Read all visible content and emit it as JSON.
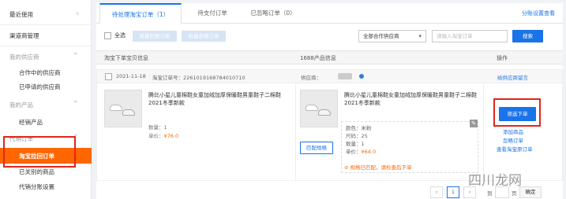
{
  "sidebar": {
    "items": [
      {
        "label": "最近使用",
        "type": "top"
      },
      {
        "label": "渠道商管理",
        "type": "top"
      },
      {
        "label": "我的供应商",
        "type": "group"
      },
      {
        "label": "合作中的供应商",
        "type": "sub"
      },
      {
        "label": "已申请的供应商",
        "type": "sub"
      },
      {
        "label": "我的产品",
        "type": "group"
      },
      {
        "label": "经销产品",
        "type": "sub"
      },
      {
        "label": "代销订单",
        "type": "group"
      },
      {
        "label": "淘宝拉回订单",
        "type": "active"
      },
      {
        "label": "已关别的商品",
        "type": "sub"
      },
      {
        "label": "代销分账设置",
        "type": "sub"
      }
    ]
  },
  "tabs": [
    {
      "label": "待处理淘宝订单（1）"
    },
    {
      "label": "待支付订单"
    },
    {
      "label": "已忽略订单（0）"
    }
  ],
  "tab_link": "分账设置查看",
  "toolbar": {
    "select_all": "全选",
    "btn_batch1": "批量匹配订单",
    "btn_batch2": "批量忽略订单",
    "supplier_select": "全部合作供应商",
    "search_placeholder": "请输入淘宝订单",
    "search_button": "搜索"
  },
  "table_header": {
    "col1": "淘宝下单宝贝信息",
    "col2": "1688产品信息",
    "col3": "操作"
  },
  "order": {
    "date": "2021-11-18",
    "order_no": "淘宝订单号：2261019168784010710",
    "supplier_label": "供应商：",
    "contact_link": "给供应商留言",
    "taobao_item": {
      "title": "腾比小星儿童棉鞋女童加绒加厚保暖鞋男童鞋子二棉鞋2021冬季新款",
      "qty": "数量：1",
      "price_label": "单价：",
      "price": "¥76.0"
    },
    "ali_item": {
      "title": "腾比小星儿童棉鞋女童加绒加厚保暖鞋男童鞋子二棉鞋2021冬季新款",
      "match_button": "匹配规格",
      "color": "颜色：米粉",
      "size": "尺码：25",
      "qty": "数量：1",
      "price_label": "单价：",
      "price": "¥64.0",
      "warning": "规格已匹配，请检查后下单"
    },
    "actions": {
      "order_button": "筛选下单",
      "add_product": "添加商品",
      "ignore_order": "忽略订单",
      "view_taobao": "查看淘宝原订单"
    }
  },
  "pager": {
    "current": "1",
    "goto": "到",
    "page": "页",
    "confirm": "确定"
  },
  "watermark": "四川龙网"
}
